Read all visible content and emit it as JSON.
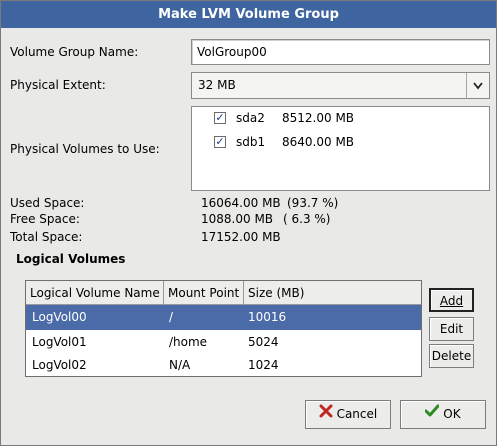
{
  "window": {
    "title": "Make LVM Volume Group"
  },
  "form": {
    "vg_name_label": "Volume Group Name:",
    "vg_name_value": "VolGroup00",
    "pe_label": "Physical Extent:",
    "pe_value": "32 MB",
    "pv_label": "Physical Volumes to Use:",
    "physical_volumes": [
      {
        "name": "sda2",
        "size": "8512.00 MB",
        "checked": true
      },
      {
        "name": "sdb1",
        "size": "8640.00 MB",
        "checked": true
      }
    ]
  },
  "space": {
    "used_label": "Used Space:",
    "used_value": "16064.00 MB",
    "used_pct": "(93.7 %)",
    "free_label": "Free Space:",
    "free_value": "1088.00 MB",
    "free_pct": "( 6.3 %)",
    "total_label": "Total Space:",
    "total_value": "17152.00 MB"
  },
  "logical_volumes": {
    "frame_title": "Logical Volumes",
    "columns": [
      "Logical Volume Name",
      "Mount Point",
      "Size (MB)"
    ],
    "rows": [
      {
        "name": "LogVol00",
        "mount": "/",
        "size": "10016",
        "selected": true
      },
      {
        "name": "LogVol01",
        "mount": "/home",
        "size": "5024",
        "selected": false
      },
      {
        "name": "LogVol02",
        "mount": "N/A",
        "size": "1024",
        "selected": false
      }
    ],
    "buttons": {
      "add": "Add",
      "edit": "Edit",
      "delete": "Delete"
    }
  },
  "footer": {
    "cancel": "Cancel",
    "ok": "OK"
  },
  "colors": {
    "titlebar": "#3e659f",
    "selection": "#4b6aa8"
  }
}
